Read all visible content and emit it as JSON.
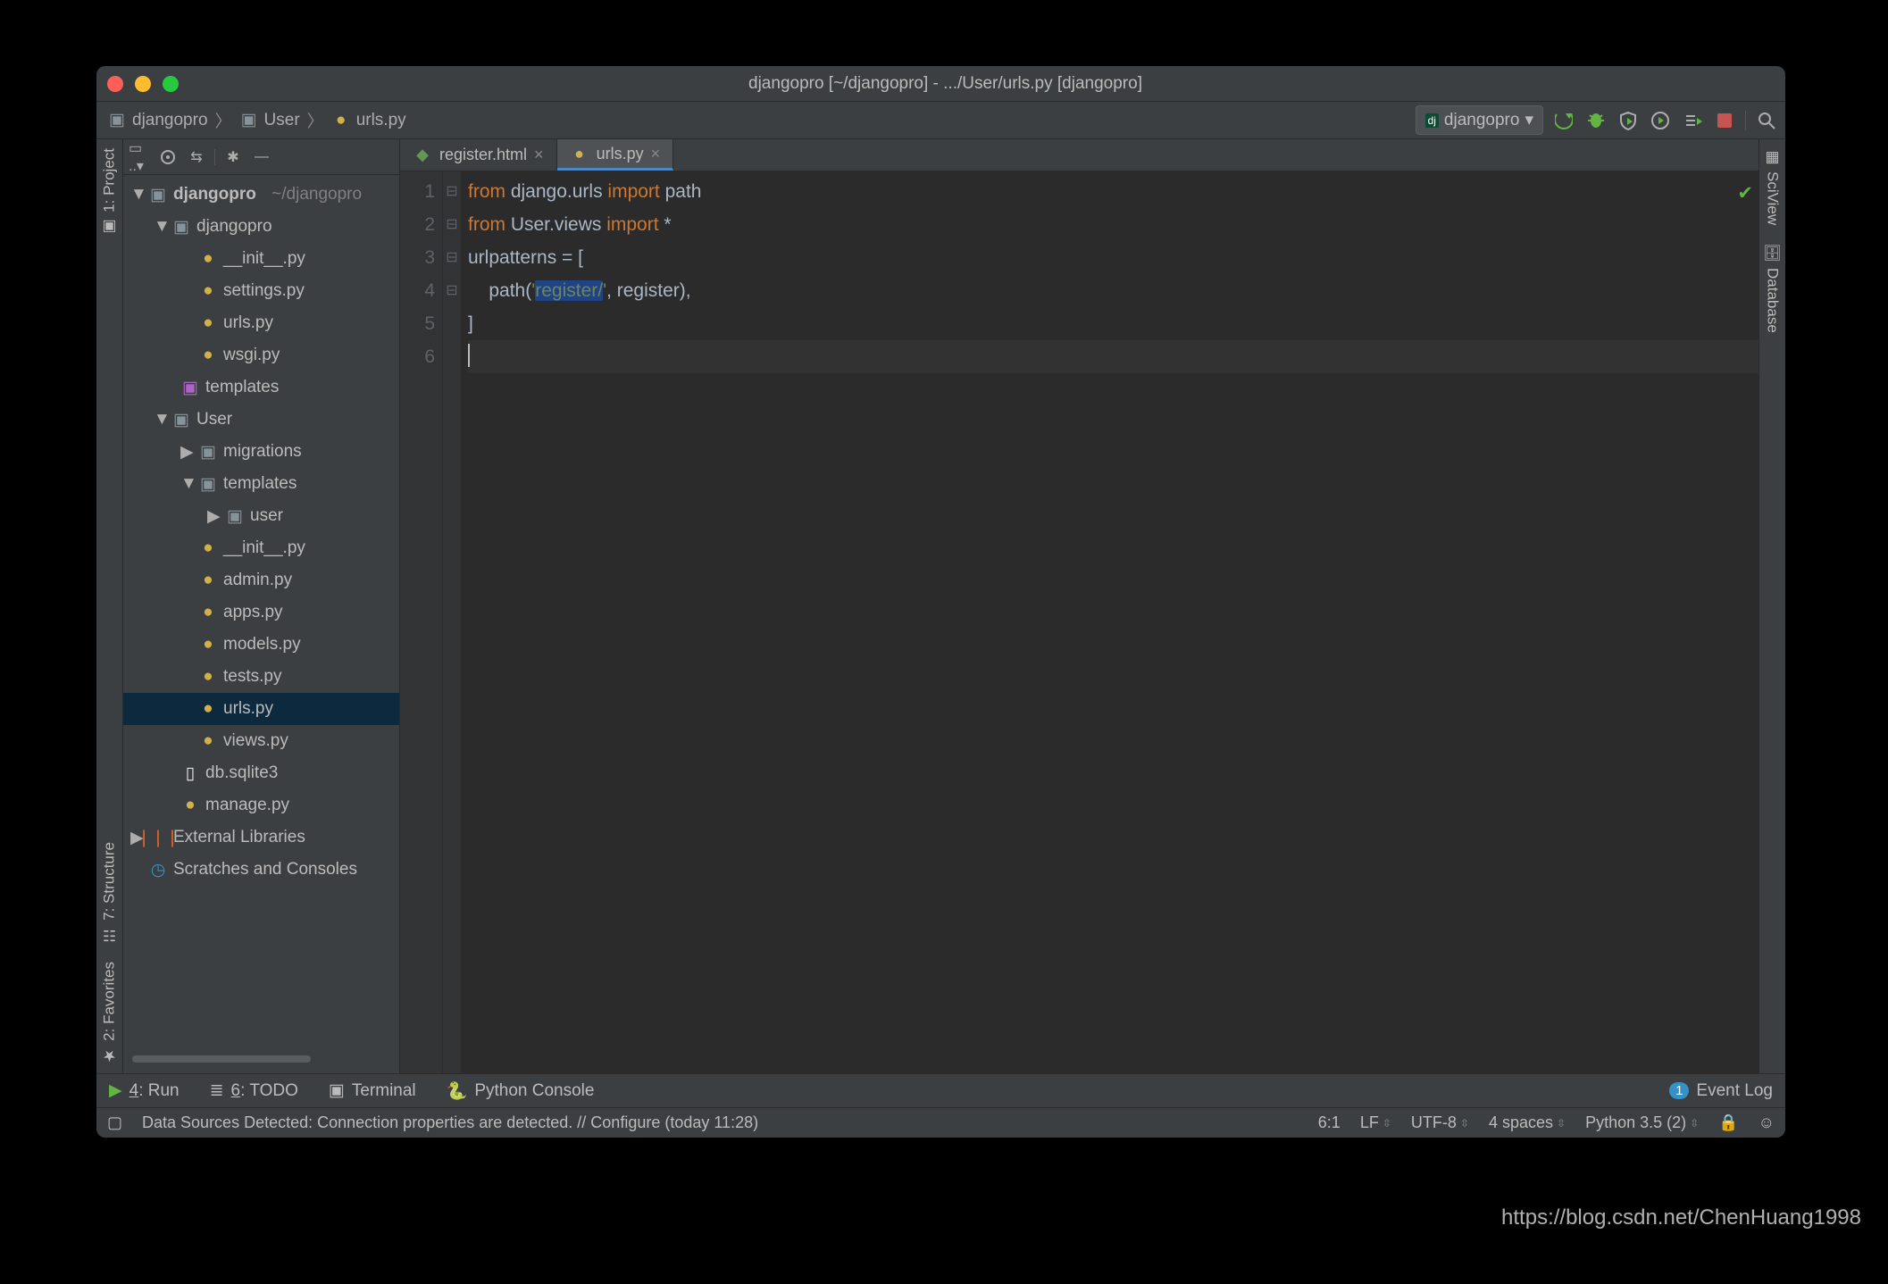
{
  "title": "djangopro [~/djangopro] - .../User/urls.py [djangopro]",
  "breadcrumb": {
    "b1": "djangopro",
    "b2": "User",
    "b3": "urls.py"
  },
  "run_config": "djangopro",
  "left_tools": {
    "project": "1: Project",
    "structure": "7: Structure",
    "favorites": "2: Favorites"
  },
  "right_tools": {
    "sciview": "SciView",
    "database": "Database"
  },
  "tree": {
    "root": "djangopro",
    "root_path": "~/djangopro",
    "djangopro": "djangopro",
    "init": "__init__.py",
    "settings": "settings.py",
    "urls1": "urls.py",
    "wsgi": "wsgi.py",
    "templates": "templates",
    "User": "User",
    "migrations": "migrations",
    "templates2": "templates",
    "user": "user",
    "init2": "__init__.py",
    "admin": "admin.py",
    "apps": "apps.py",
    "models": "models.py",
    "tests": "tests.py",
    "urls2": "urls.py",
    "views": "views.py",
    "db": "db.sqlite3",
    "manage": "manage.py",
    "extlib": "External Libraries",
    "scratches": "Scratches and Consoles"
  },
  "tabs": {
    "t1": "register.html",
    "t2": "urls.py"
  },
  "code": {
    "l1a": "from",
    "l1b": " django.urls ",
    "l1c": "import",
    "l1d": " path",
    "l2a": "from",
    "l2b": " User.views ",
    "l2c": "import",
    "l2d": " *",
    "l3": "urlpatterns = [",
    "l4a": "    path(",
    "l4b": "'",
    "l4c": "register/",
    "l4d": "'",
    "l4e": ", register),",
    "l5": "]",
    "ln1": "1",
    "ln2": "2",
    "ln3": "3",
    "ln4": "4",
    "ln5": "5",
    "ln6": "6"
  },
  "bottom": {
    "run": "4: Run",
    "todo": "6: TODO",
    "terminal": "Terminal",
    "pyconsole": "Python Console",
    "eventlog": "Event Log"
  },
  "status": {
    "msg": "Data Sources Detected: Connection properties are detected. // Configure (today 11:28)",
    "pos": "6:1",
    "le": "LF",
    "enc": "UTF-8",
    "indent": "4 spaces",
    "py": "Python 3.5 (2)"
  },
  "watermark": "https://blog.csdn.net/ChenHuang1998"
}
